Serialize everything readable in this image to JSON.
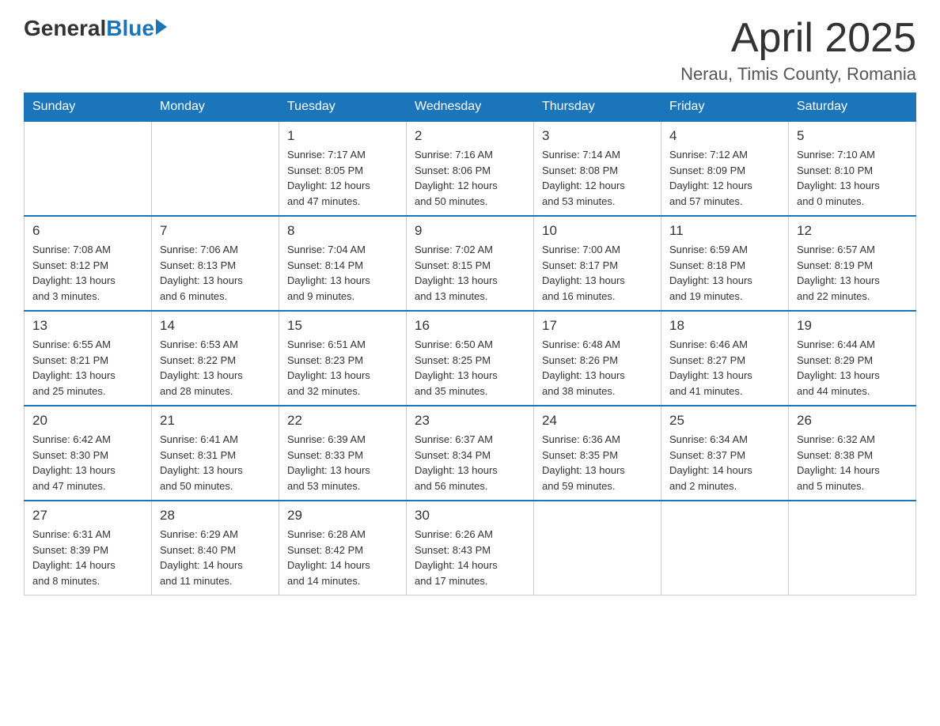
{
  "header": {
    "logo": {
      "general": "General",
      "blue": "Blue"
    },
    "title": "April 2025",
    "location": "Nerau, Timis County, Romania"
  },
  "calendar": {
    "days_of_week": [
      "Sunday",
      "Monday",
      "Tuesday",
      "Wednesday",
      "Thursday",
      "Friday",
      "Saturday"
    ],
    "weeks": [
      [
        {
          "day": "",
          "info": ""
        },
        {
          "day": "",
          "info": ""
        },
        {
          "day": "1",
          "info": "Sunrise: 7:17 AM\nSunset: 8:05 PM\nDaylight: 12 hours\nand 47 minutes."
        },
        {
          "day": "2",
          "info": "Sunrise: 7:16 AM\nSunset: 8:06 PM\nDaylight: 12 hours\nand 50 minutes."
        },
        {
          "day": "3",
          "info": "Sunrise: 7:14 AM\nSunset: 8:08 PM\nDaylight: 12 hours\nand 53 minutes."
        },
        {
          "day": "4",
          "info": "Sunrise: 7:12 AM\nSunset: 8:09 PM\nDaylight: 12 hours\nand 57 minutes."
        },
        {
          "day": "5",
          "info": "Sunrise: 7:10 AM\nSunset: 8:10 PM\nDaylight: 13 hours\nand 0 minutes."
        }
      ],
      [
        {
          "day": "6",
          "info": "Sunrise: 7:08 AM\nSunset: 8:12 PM\nDaylight: 13 hours\nand 3 minutes."
        },
        {
          "day": "7",
          "info": "Sunrise: 7:06 AM\nSunset: 8:13 PM\nDaylight: 13 hours\nand 6 minutes."
        },
        {
          "day": "8",
          "info": "Sunrise: 7:04 AM\nSunset: 8:14 PM\nDaylight: 13 hours\nand 9 minutes."
        },
        {
          "day": "9",
          "info": "Sunrise: 7:02 AM\nSunset: 8:15 PM\nDaylight: 13 hours\nand 13 minutes."
        },
        {
          "day": "10",
          "info": "Sunrise: 7:00 AM\nSunset: 8:17 PM\nDaylight: 13 hours\nand 16 minutes."
        },
        {
          "day": "11",
          "info": "Sunrise: 6:59 AM\nSunset: 8:18 PM\nDaylight: 13 hours\nand 19 minutes."
        },
        {
          "day": "12",
          "info": "Sunrise: 6:57 AM\nSunset: 8:19 PM\nDaylight: 13 hours\nand 22 minutes."
        }
      ],
      [
        {
          "day": "13",
          "info": "Sunrise: 6:55 AM\nSunset: 8:21 PM\nDaylight: 13 hours\nand 25 minutes."
        },
        {
          "day": "14",
          "info": "Sunrise: 6:53 AM\nSunset: 8:22 PM\nDaylight: 13 hours\nand 28 minutes."
        },
        {
          "day": "15",
          "info": "Sunrise: 6:51 AM\nSunset: 8:23 PM\nDaylight: 13 hours\nand 32 minutes."
        },
        {
          "day": "16",
          "info": "Sunrise: 6:50 AM\nSunset: 8:25 PM\nDaylight: 13 hours\nand 35 minutes."
        },
        {
          "day": "17",
          "info": "Sunrise: 6:48 AM\nSunset: 8:26 PM\nDaylight: 13 hours\nand 38 minutes."
        },
        {
          "day": "18",
          "info": "Sunrise: 6:46 AM\nSunset: 8:27 PM\nDaylight: 13 hours\nand 41 minutes."
        },
        {
          "day": "19",
          "info": "Sunrise: 6:44 AM\nSunset: 8:29 PM\nDaylight: 13 hours\nand 44 minutes."
        }
      ],
      [
        {
          "day": "20",
          "info": "Sunrise: 6:42 AM\nSunset: 8:30 PM\nDaylight: 13 hours\nand 47 minutes."
        },
        {
          "day": "21",
          "info": "Sunrise: 6:41 AM\nSunset: 8:31 PM\nDaylight: 13 hours\nand 50 minutes."
        },
        {
          "day": "22",
          "info": "Sunrise: 6:39 AM\nSunset: 8:33 PM\nDaylight: 13 hours\nand 53 minutes."
        },
        {
          "day": "23",
          "info": "Sunrise: 6:37 AM\nSunset: 8:34 PM\nDaylight: 13 hours\nand 56 minutes."
        },
        {
          "day": "24",
          "info": "Sunrise: 6:36 AM\nSunset: 8:35 PM\nDaylight: 13 hours\nand 59 minutes."
        },
        {
          "day": "25",
          "info": "Sunrise: 6:34 AM\nSunset: 8:37 PM\nDaylight: 14 hours\nand 2 minutes."
        },
        {
          "day": "26",
          "info": "Sunrise: 6:32 AM\nSunset: 8:38 PM\nDaylight: 14 hours\nand 5 minutes."
        }
      ],
      [
        {
          "day": "27",
          "info": "Sunrise: 6:31 AM\nSunset: 8:39 PM\nDaylight: 14 hours\nand 8 minutes."
        },
        {
          "day": "28",
          "info": "Sunrise: 6:29 AM\nSunset: 8:40 PM\nDaylight: 14 hours\nand 11 minutes."
        },
        {
          "day": "29",
          "info": "Sunrise: 6:28 AM\nSunset: 8:42 PM\nDaylight: 14 hours\nand 14 minutes."
        },
        {
          "day": "30",
          "info": "Sunrise: 6:26 AM\nSunset: 8:43 PM\nDaylight: 14 hours\nand 17 minutes."
        },
        {
          "day": "",
          "info": ""
        },
        {
          "day": "",
          "info": ""
        },
        {
          "day": "",
          "info": ""
        }
      ]
    ]
  }
}
